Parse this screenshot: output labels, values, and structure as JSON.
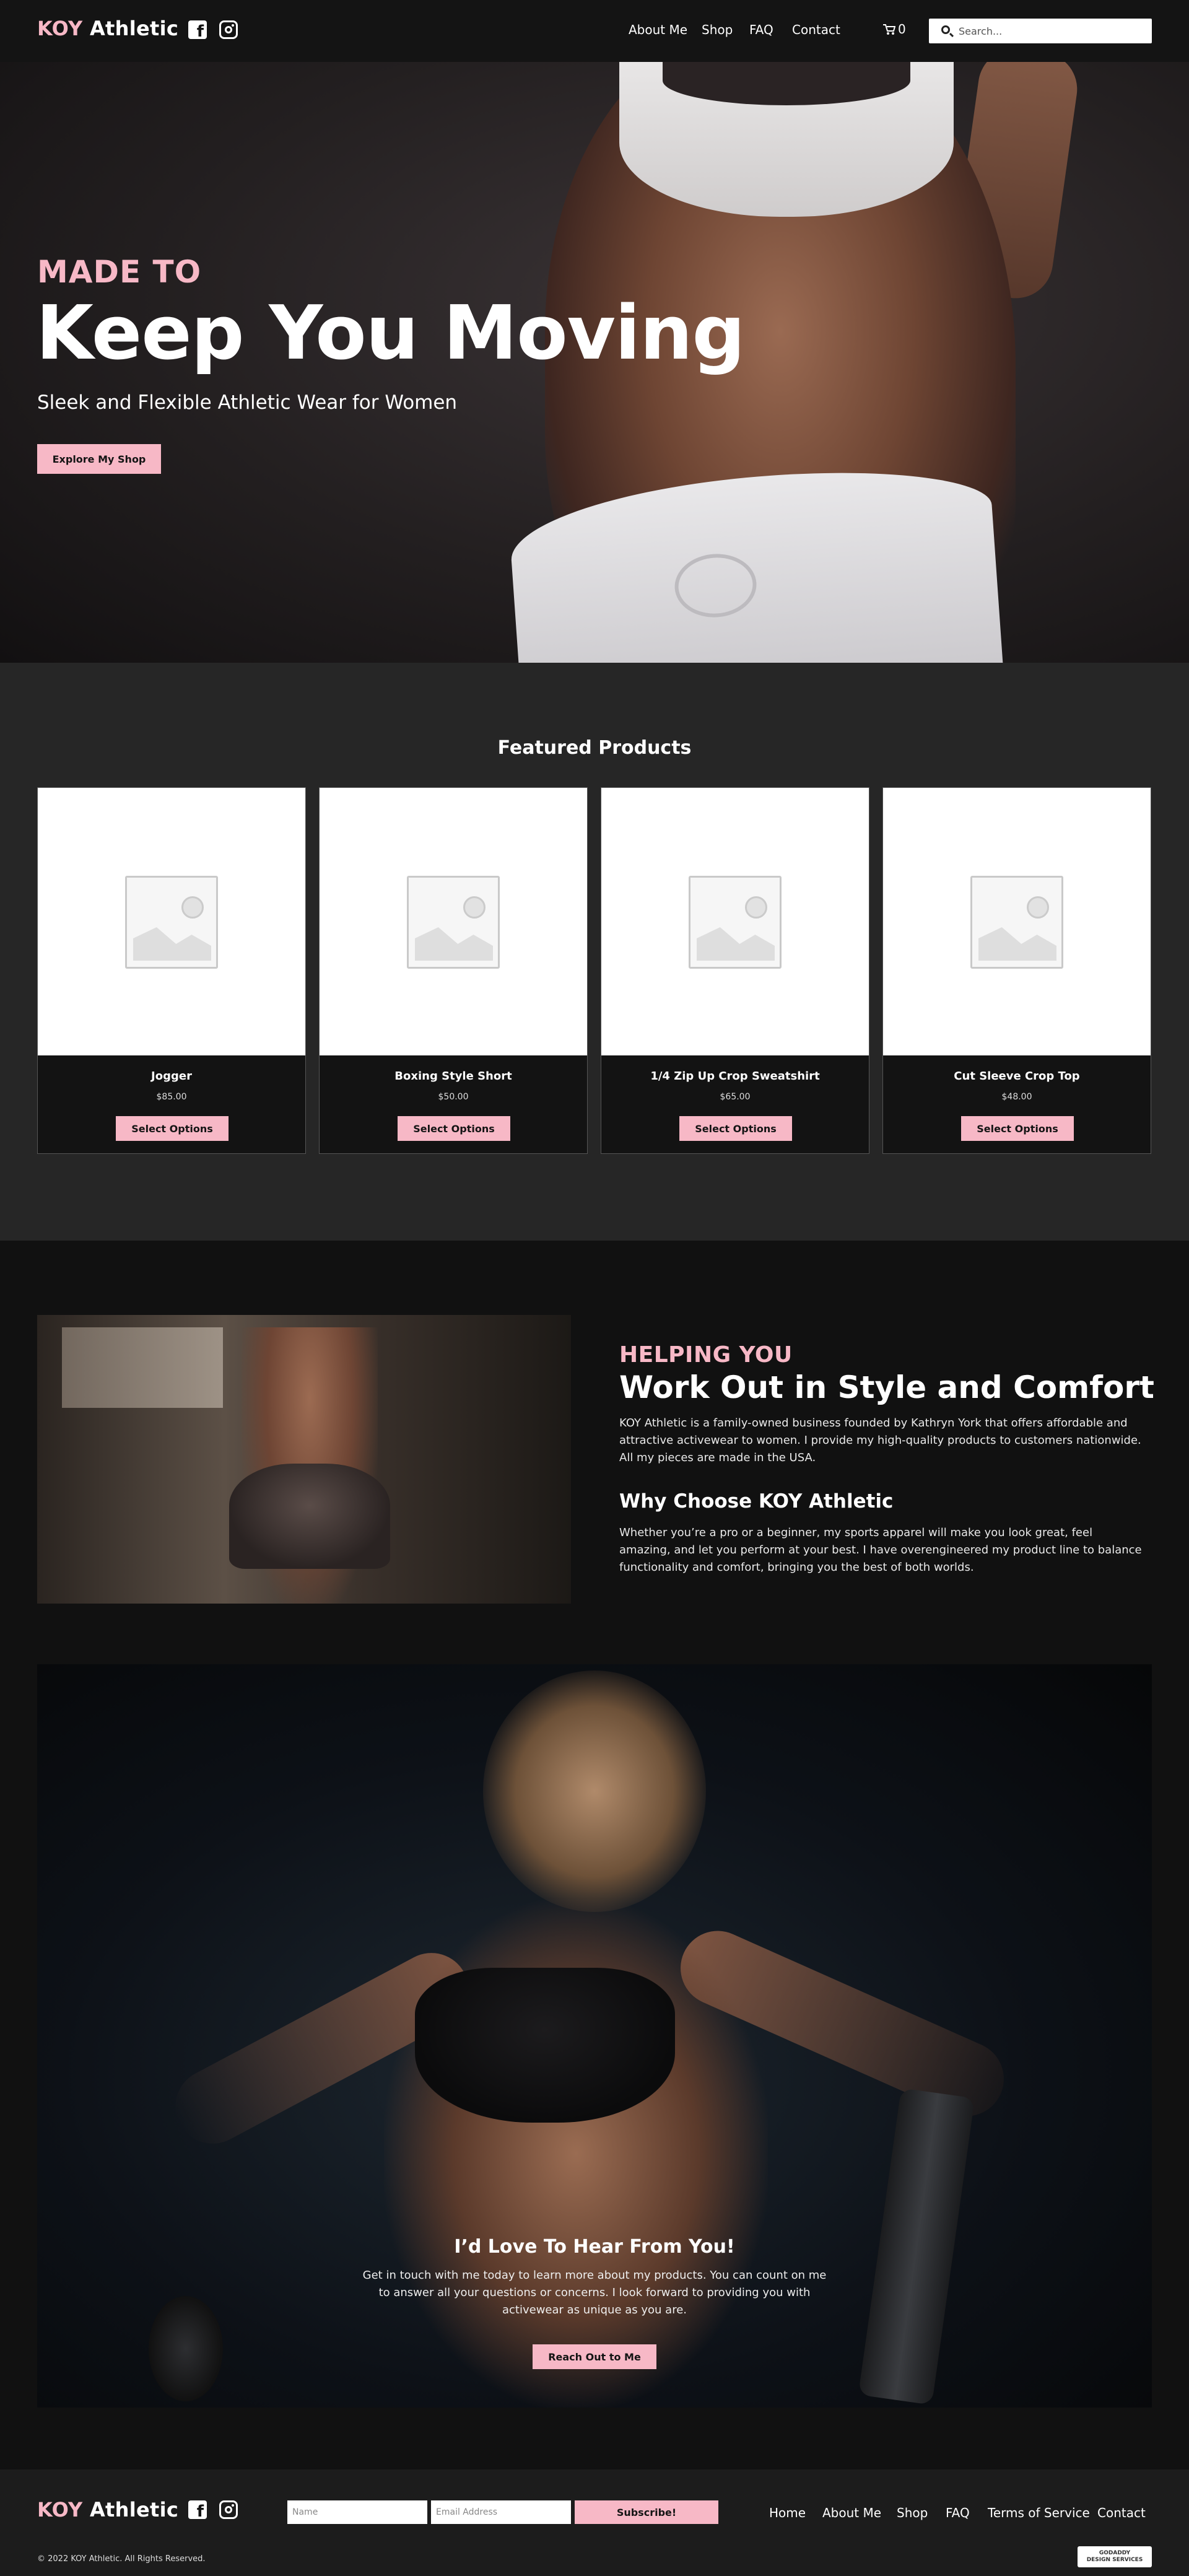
{
  "header": {
    "logo_accent": "KOY",
    "logo_text": "Athletic",
    "nav": [
      "About Me",
      "Shop",
      "FAQ",
      "Contact"
    ],
    "cart_count": "0",
    "search_placeholder": "Search..."
  },
  "hero": {
    "subtitle": "MADE TO",
    "title": "Keep You Moving",
    "tagline": "Sleek and Flexible Athletic Wear for Women",
    "button": "Explore My Shop"
  },
  "featured": {
    "heading": "Featured Products",
    "products": [
      {
        "name": "Jogger",
        "price": "$85.00",
        "button": "Select Options"
      },
      {
        "name": "Boxing Style Short",
        "price": "$50.00",
        "button": "Select Options"
      },
      {
        "name": "1/4 Zip Up Crop Sweatshirt",
        "price": "$65.00",
        "button": "Select Options"
      },
      {
        "name": "Cut Sleeve Crop Top",
        "price": "$48.00",
        "button": "Select Options"
      }
    ]
  },
  "about": {
    "kicker": "HELPING YOU",
    "title": "Work Out in Style and Comfort",
    "paragraph1": "KOY Athletic is a family-owned business founded by Kathryn York that offers affordable and attractive activewear to women. I provide my high-quality products to customers nationwide. All my pieces are made in the USA.",
    "subheading": "Why Choose KOY Athletic",
    "paragraph2": "Whether you’re a pro or a beginner, my sports apparel will make you look great, feel amazing, and let you perform at your best. I have overengineered my product line to balance functionality and comfort, bringing you the best of both worlds."
  },
  "contact": {
    "heading": "I’d Love To Hear From You!",
    "text": "Get in touch with me today to learn more about my products. You can count on me to answer all your questions or concerns. I look forward to providing you with activewear as unique as you are.",
    "button": "Reach Out to Me"
  },
  "footer": {
    "name_placeholder": "Name",
    "email_placeholder": "Email Address",
    "subscribe": "Subscribe!",
    "nav": [
      "Home",
      "About Me",
      "Shop",
      "FAQ",
      "Terms of Service",
      "Contact"
    ],
    "copyright": "© 2022 KOY Athletic. All Rights Reserved.",
    "badge_line1": "GODADDY",
    "badge_line2": "DESIGN SERVICES"
  },
  "colors": {
    "accent_pink": "#f7b8c6",
    "header_bg": "#141414",
    "featured_bg": "#262626",
    "section_bg": "#111111"
  },
  "icons": [
    "facebook-icon",
    "instagram-icon",
    "cart-icon",
    "search-icon",
    "placeholder-image-icon"
  ]
}
